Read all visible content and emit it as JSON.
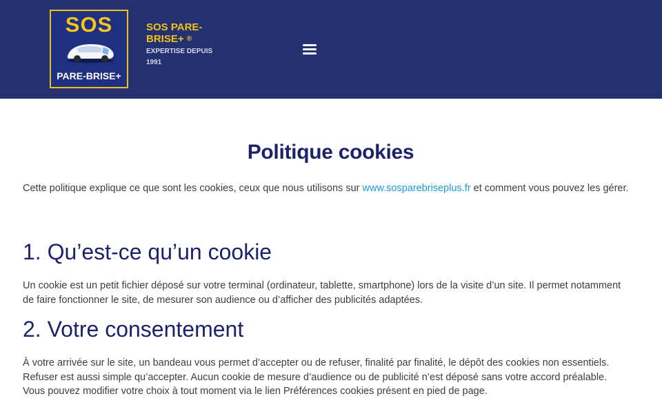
{
  "header": {
    "logo": {
      "top_text": "SOS",
      "bottom_text": "PARE-BRISE+"
    },
    "brand_name": "SOS PARE-BRISE+",
    "brand_mark": "®",
    "tagline": "EXPERTISE DEPUIS 1991",
    "menu_icon": "hamburger-icon"
  },
  "page": {
    "title": "Politique cookies",
    "intro_before": "Cette politique explique ce que sont les cookies, ceux que nous utilisons sur ",
    "intro_link": "www.sosparebriseplus.fr",
    "intro_after": " et comment vous pouvez les gérer.",
    "sections": [
      {
        "heading": "1. Qu’est-ce qu’un cookie",
        "text": "Un cookie est un petit fichier déposé sur votre terminal (ordinateur, tablette, smartphone) lors de la visite d’un site. Il permet notamment de faire fonctionner le site, de mesurer son audience ou d’afficher des publicités adaptées."
      },
      {
        "heading": "2. Votre consentement",
        "text": "À votre arrivée sur le site, un bandeau vous permet d’accepter ou de refuser, finalité par finalité, le dépôt des cookies non essentiels. Refuser est aussi simple qu’accepter. Aucun cookie de mesure d’audience ou de publicité n’est déposé sans votre accord préalable. Vous pouvez modifier votre choix à tout moment via le lien Préférences cookies présent en pied de page."
      }
    ]
  },
  "colors": {
    "header_bg": "#233170",
    "brand_yellow": "#f2c21b",
    "heading": "#1d236b",
    "link": "#1a9bdb"
  }
}
